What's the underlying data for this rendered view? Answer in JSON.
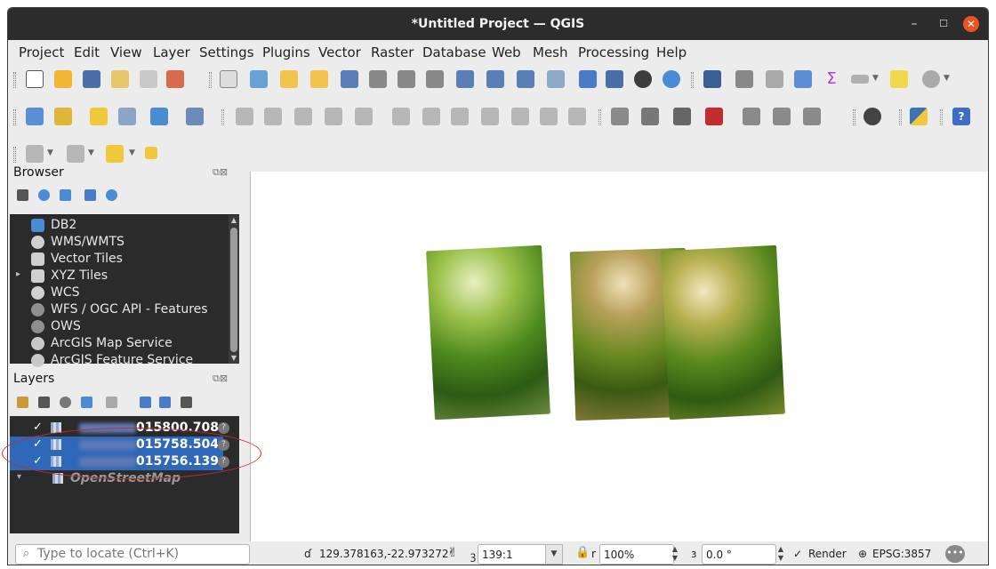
{
  "window": {
    "title": "*Untitled Project — QGIS",
    "controls": {
      "minimize": "–",
      "maximize": "☐",
      "close": "✕"
    }
  },
  "menubar": {
    "items": [
      "Project",
      "Edit",
      "View",
      "Layer",
      "Settings",
      "Plugins",
      "Vector",
      "Raster",
      "Database",
      "Web",
      "Mesh",
      "Processing",
      "Help"
    ]
  },
  "toolbars": {
    "icons": [
      "new-project-icon",
      "open-project-icon",
      "save-project-icon",
      "save-as-icon",
      "print-layout-icon",
      "style-manager-icon",
      "pan-icon",
      "pan-to-selection-icon",
      "zoom-in-icon",
      "zoom-out-icon",
      "zoom-full-icon",
      "zoom-to-selection-icon",
      "zoom-to-layer-icon",
      "zoom-native-icon",
      "zoom-last-icon",
      "zoom-next-icon",
      "new-map-view-icon",
      "new-3d-view-icon",
      "bookmark-icon",
      "show-bookmarks-icon",
      "temporal-controller-icon",
      "refresh-icon",
      "identify-icon",
      "attribute-table-icon",
      "field-calculator-icon",
      "processing-toolbox-icon",
      "statistics-icon",
      "measure-icon",
      "map-tips-icon",
      "select-icon"
    ]
  },
  "browser": {
    "title": "Browser",
    "items": [
      {
        "label": "DB2",
        "icon": "db2-icon",
        "color": "#4a8bd6"
      },
      {
        "label": "WMS/WMTS",
        "icon": "globe-icon",
        "color": "#d0d0d0"
      },
      {
        "label": "Vector Tiles",
        "icon": "grid-icon",
        "color": "#cfcfcf"
      },
      {
        "label": "XYZ Tiles",
        "icon": "grid-icon",
        "color": "#cfcfcf",
        "expandable": true
      },
      {
        "label": "WCS",
        "icon": "wcs-icon",
        "color": "#d0d0d0"
      },
      {
        "label": "WFS / OGC API - Features",
        "icon": "globe-icon",
        "color": "#8f8f8f"
      },
      {
        "label": "OWS",
        "icon": "globe-icon",
        "color": "#8f8f8f"
      },
      {
        "label": "ArcGIS Map Service",
        "icon": "arcgis-icon",
        "color": "#c8c8c8"
      },
      {
        "label": "ArcGIS Feature Service",
        "icon": "arcgis-icon",
        "color": "#c8c8c8"
      }
    ]
  },
  "layers": {
    "title": "Layers",
    "items": [
      {
        "label": "015800.7083",
        "checked": true,
        "selected": false
      },
      {
        "label": "015758.5045",
        "checked": true,
        "selected": true
      },
      {
        "label": "015756.1394",
        "checked": true,
        "selected": true
      },
      {
        "label": "OpenStreetMap",
        "checked": false,
        "selected": false,
        "group": true
      }
    ]
  },
  "statusbar": {
    "locate_placeholder": "Type to locate (Ctrl+K)",
    "coordinate_label": "ɗ",
    "coordinate": "129.378163,-22.973272",
    "scale_label": "ꝫ",
    "scale": "139:1",
    "magnifier_label": "r",
    "magnifier": "100%",
    "rotation_label": "ɜ",
    "rotation": "0.0 °",
    "render_label": "Render",
    "render_checked": "✓",
    "crs": "EPSG:3857"
  },
  "colors": {
    "accent": "#2f68b9",
    "annotation_red": "#c42b2b",
    "title_bar": "#2c2c2c",
    "close_button": "#e95420"
  }
}
